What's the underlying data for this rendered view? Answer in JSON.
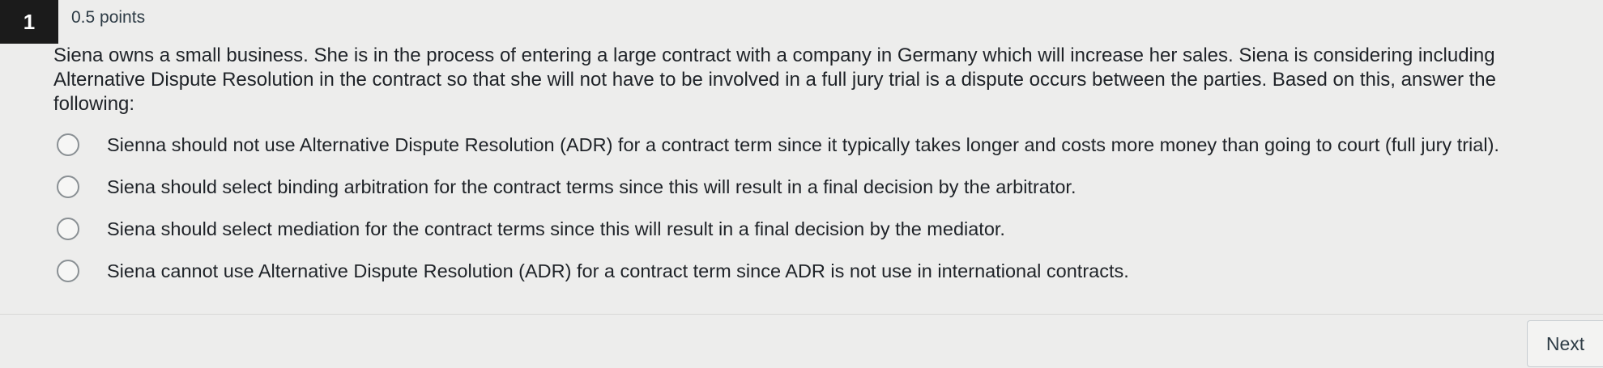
{
  "question": {
    "number": "1",
    "points": "0.5 points",
    "text": "Siena owns a small business.  She is in the process of entering a large contract with a company in Germany which will increase her sales.  Siena is considering including Alternative Dispute Resolution in the contract so that she will not have to be involved in a full jury trial is a dispute occurs between the parties.  Based on this, answer the following:",
    "options": [
      {
        "label": "Sienna should not use Alternative Dispute Resolution (ADR) for a contract term since it typically takes longer and costs more money than going to court (full jury trial).",
        "selected": false
      },
      {
        "label": "Siena should select binding arbitration for the contract terms since this will result in a final decision by the arbitrator.",
        "selected": false
      },
      {
        "label": "Siena should select mediation for the contract terms since this will result in a final decision by the mediator.",
        "selected": false
      },
      {
        "label": "Siena cannot use Alternative Dispute Resolution (ADR) for a contract term since ADR is not use in international contracts.",
        "selected": false
      }
    ]
  },
  "navigation": {
    "next_label": "Next"
  },
  "colors": {
    "background": "#ededec",
    "number_badge": "#1b1b1b",
    "text": "#1f2328"
  }
}
